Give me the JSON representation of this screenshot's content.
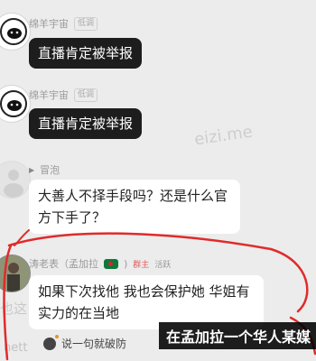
{
  "messages": [
    {
      "sender": "绵羊宇宙",
      "tag": "低调",
      "text": "直播肯定被举报"
    },
    {
      "sender": "绵羊宇宙",
      "tag": "低调",
      "text": "直播肯定被举报"
    },
    {
      "sender": "冒泡",
      "text": "大善人不择手段吗？还是什么官方下手了？"
    },
    {
      "sender": "涛老表（孟加拉",
      "role": "群主",
      "level": "活跃",
      "text": "如果下次找他 我也会保护她 华姐有实力的在当地"
    }
  ],
  "input_hint": "说一句就破防",
  "overlay_caption": "在孟加拉一个华人某媒",
  "watermark": "eizi.me",
  "faded_left": "也这",
  "faded_left2": "nett",
  "colors": {
    "annotation_red": "#e02b2b",
    "dark_bubble": "#1d1d1d",
    "background": "#ececec"
  }
}
